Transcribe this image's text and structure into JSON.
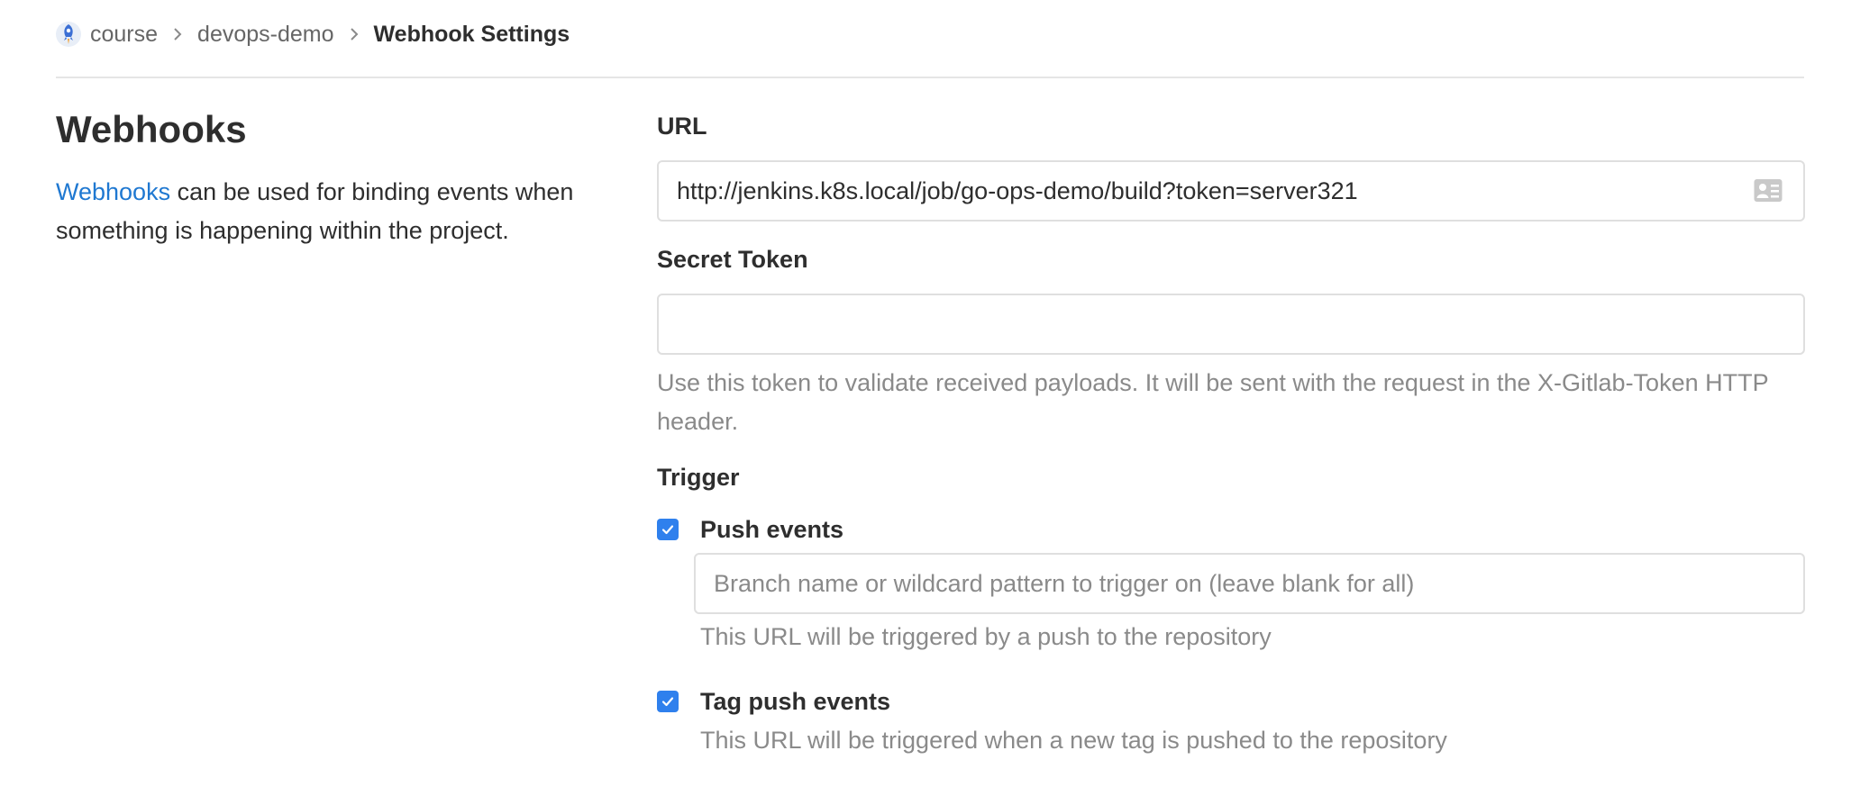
{
  "breadcrumb": {
    "items": [
      "course",
      "devops-demo"
    ],
    "current": "Webhook Settings"
  },
  "section": {
    "title": "Webhooks",
    "link_text": "Webhooks",
    "description": " can be used for binding events when something is happening within the project."
  },
  "form": {
    "url": {
      "label": "URL",
      "value": "http://jenkins.k8s.local/job/go-ops-demo/build?token=server321"
    },
    "secret_token": {
      "label": "Secret Token",
      "value": "",
      "help": "Use this token to validate received payloads. It will be sent with the request in the X-Gitlab-Token HTTP header."
    },
    "trigger": {
      "label": "Trigger",
      "push_events": {
        "label": "Push events",
        "checked": true,
        "branch_placeholder": "Branch name or wildcard pattern to trigger on (leave blank for all)",
        "help": "This URL will be triggered by a push to the repository"
      },
      "tag_push_events": {
        "label": "Tag push events",
        "checked": true,
        "help": "This URL will be triggered when a new tag is pushed to the repository"
      }
    }
  },
  "colors": {
    "link": "#1f78d1",
    "checkbox": "#2f80ed",
    "muted_text": "#8a8a8a"
  }
}
